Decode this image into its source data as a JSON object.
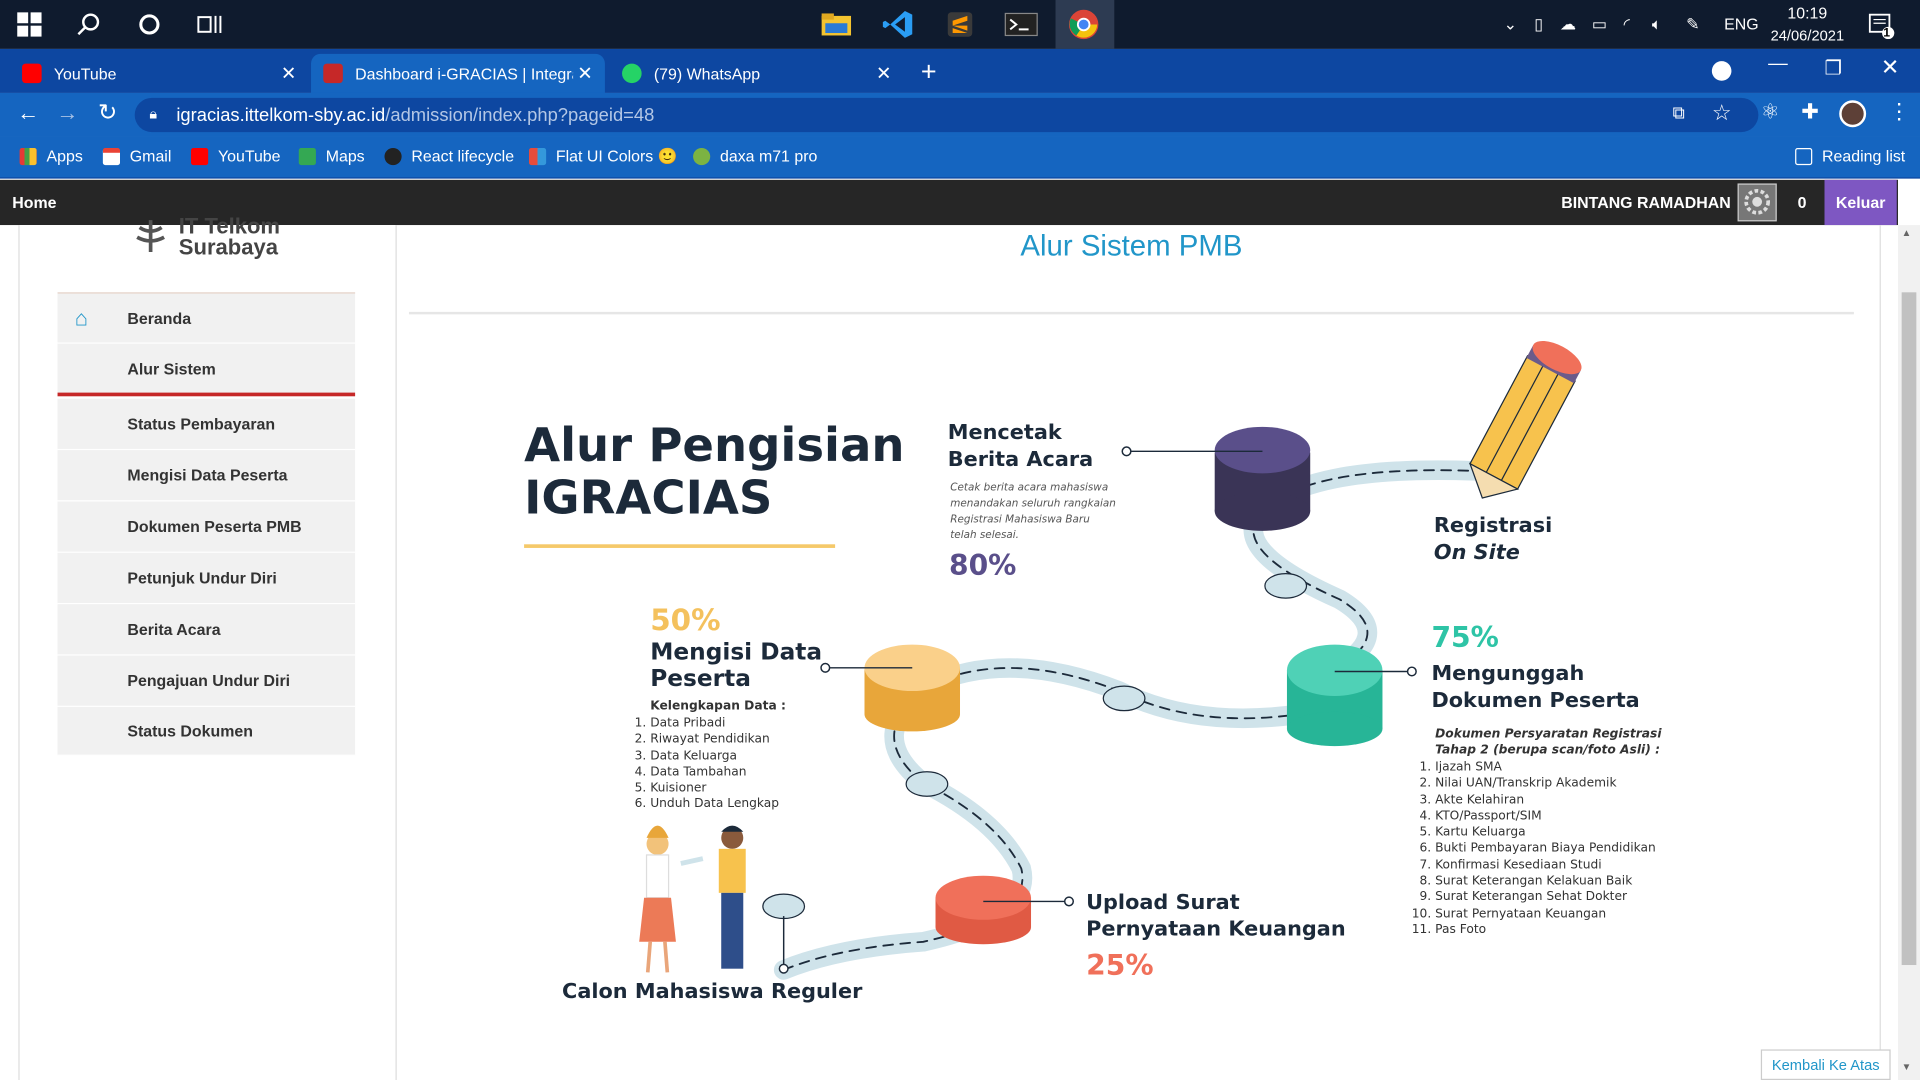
{
  "taskbar": {
    "time": "10:19",
    "date": "24/06/2021",
    "lang": "ENG",
    "notif_count": "1"
  },
  "tabs": [
    {
      "label": "YouTube",
      "color": "#ff0000"
    },
    {
      "label": "Dashboard i-GRACIAS | Integrate",
      "color": "#c62828"
    },
    {
      "label": "(79) WhatsApp",
      "color": "#25d366"
    }
  ],
  "address": {
    "host": "igracias.ittelkom-sby.ac.id",
    "path": "/admission/index.php?pageid=48"
  },
  "bookmarks": [
    "Apps",
    "Gmail",
    "YouTube",
    "Maps",
    "React lifecycle",
    "Flat UI Colors 🙂",
    "daxa m71 pro"
  ],
  "reading_list": "Reading list",
  "site": {
    "home": "Home",
    "user": "BINTANG RAMADHAN",
    "count": "0",
    "logout": "Keluar",
    "logo1": "IT Telkom",
    "logo2": "Surabaya",
    "back_top": "Kembali Ke Atas"
  },
  "menu": [
    "Beranda",
    "Alur Sistem",
    "Status Pembayaran",
    "Mengisi Data Peserta",
    "Dokumen Peserta PMB",
    "Petunjuk Undur Diri",
    "Berita Acara",
    "Pengajuan Undur Diri",
    "Status Dokumen"
  ],
  "page_title": "Alur Sistem PMB",
  "info": {
    "title1": "Alur Pengisian",
    "title2": "IGRACIAS",
    "s1_pct": "50%",
    "s1_t1": "Mengisi Data",
    "s1_t2": "Peserta",
    "s1_sub": "Kelengkapan Data :",
    "s1_items": [
      "Data Pribadi",
      "Riwayat Pendidikan",
      "Data Keluarga",
      "Data Tambahan",
      "Kuisioner",
      "Unduh Data Lengkap"
    ],
    "s2_t1": "Mencetak",
    "s2_t2": "Berita Acara",
    "s2_desc": [
      "Cetak berita acara mahasiswa",
      "menandakan seluruh rangkaian",
      "Registrasi Mahasiswa Baru",
      "telah selesai."
    ],
    "s2_pct": "80%",
    "s3_t1": "Registrasi",
    "s3_t2": "On Site",
    "s4_pct": "75%",
    "s4_t1": "Mengunggah",
    "s4_t2": "Dokumen Peserta",
    "s4_sub1": "Dokumen Persyaratan Registrasi",
    "s4_sub2": "Tahap 2 (berupa scan/foto Asli) :",
    "s4_items": [
      "Ijazah SMA",
      "Nilai UAN/Transkrip Akademik",
      "Akte Kelahiran",
      "KTO/Passport/SIM",
      "Kartu Keluarga",
      "Bukti Pembayaran Biaya Pendidikan",
      "Konfirmasi Kesediaan Studi",
      "Surat Keterangan Kelakuan Baik",
      "Surat Keterangan Sehat Dokter",
      "Surat Pernyataan Keuangan",
      "Pas Foto"
    ],
    "s5_t1": "Upload Surat",
    "s5_t2": "Pernyataan Keuangan",
    "s5_pct": "25%",
    "start": "Calon Mahasiswa Reguler"
  },
  "colors": {
    "tab_bar": "#0d47a1",
    "accent_red": "#c62828",
    "purple_btn": "#7e57c2",
    "title_blue": "#2196c9",
    "pct50": "#f4c15d",
    "pct80": "#5a4f8a",
    "pct75": "#2ec4a6",
    "pct25": "#f0705a"
  }
}
